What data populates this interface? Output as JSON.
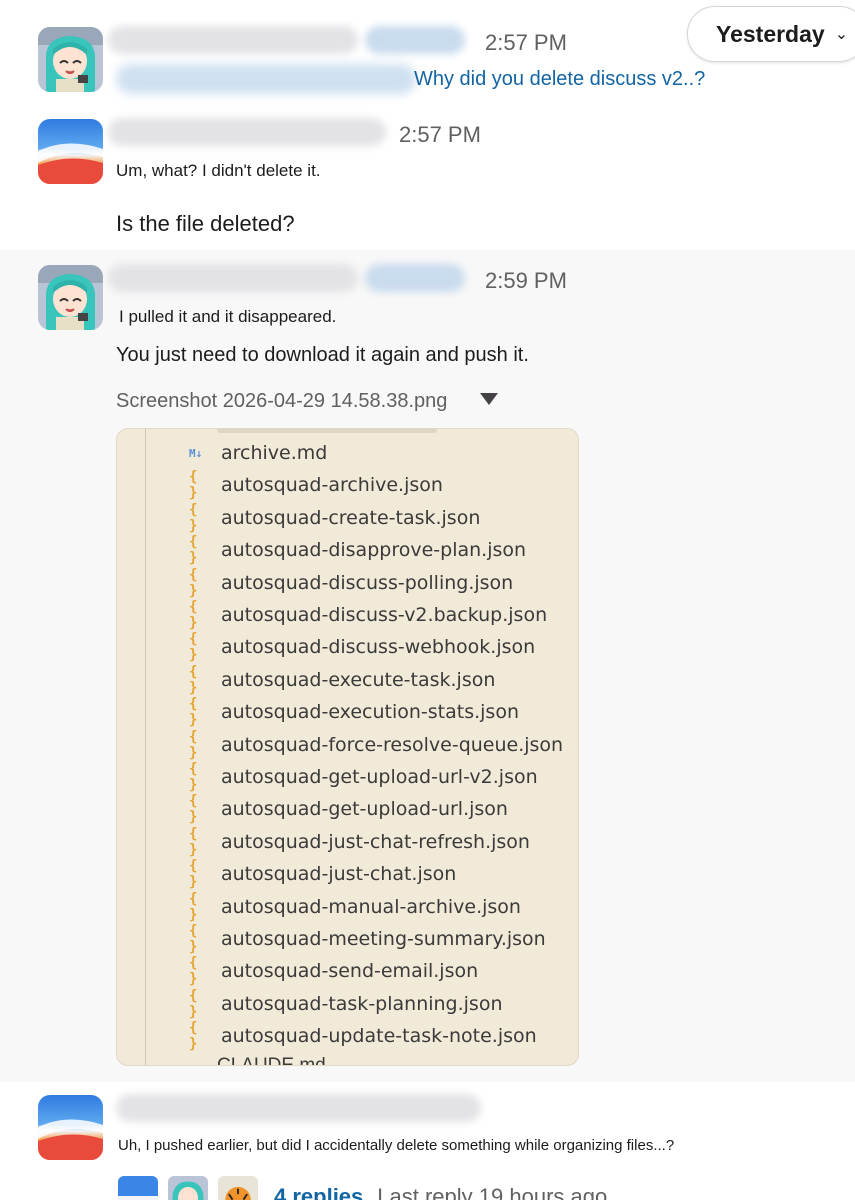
{
  "header": {
    "date_divider": "Yesterday",
    "chevron": "chevron-down-icon"
  },
  "messages": [
    {
      "id": "m1",
      "avatar": "anime-girl-avatar",
      "time": "2:57 PM",
      "quote_link": "Why did you delete discuss v2..?"
    },
    {
      "id": "m2",
      "avatar": "macos-wallpaper-avatar",
      "time": "2:57 PM",
      "text": "Um, what? I didn't delete it.",
      "followup": "Is the file deleted?"
    },
    {
      "id": "m3",
      "avatar": "anime-girl-avatar",
      "time": "2:59 PM",
      "text": "I pulled it and it disappeared.",
      "followup": "You just need to download it again and push it.",
      "attachment": {
        "filename": "Screenshot 2026-04-29 14.58.38.png",
        "file_icon_md": "M↓",
        "file_icon_json": "{ }",
        "files": [
          "archive.md",
          "autosquad-archive.json",
          "autosquad-create-task.json",
          "autosquad-disapprove-plan.json",
          "autosquad-discuss-polling.json",
          "autosquad-discuss-v2.backup.json",
          "autosquad-discuss-webhook.json",
          "autosquad-execute-task.json",
          "autosquad-execution-stats.json",
          "autosquad-force-resolve-queue.json",
          "autosquad-get-upload-url-v2.json",
          "autosquad-get-upload-url.json",
          "autosquad-just-chat-refresh.json",
          "autosquad-just-chat.json",
          "autosquad-manual-archive.json",
          "autosquad-meeting-summary.json",
          "autosquad-send-email.json",
          "autosquad-task-planning.json",
          "autosquad-update-task-note.json"
        ],
        "cut_bottom": "CLAUDE.md"
      }
    },
    {
      "id": "m4",
      "avatar": "macos-wallpaper-avatar",
      "text": "Uh, I pushed earlier, but did I accidentally delete something while organizing files...?",
      "thread": {
        "replies": "4 replies",
        "last_reply": "Last reply 19 hours ago"
      }
    }
  ],
  "colors": {
    "link": "#1264a3",
    "timestamp": "#616061",
    "highlight_bg": "#f8f8f8",
    "screenshot_bg": "#f2ead8",
    "json_icon": "#e5a431"
  }
}
